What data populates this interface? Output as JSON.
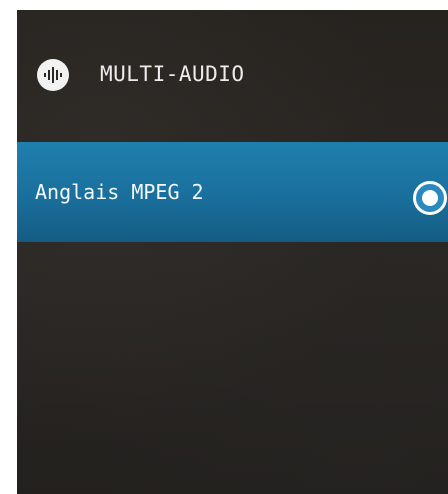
{
  "header": {
    "icon": "audio-waveform-icon",
    "title": "MULTI-AUDIO"
  },
  "options": [
    {
      "label": "Anglais MPEG 2",
      "selected": true
    }
  ],
  "colors": {
    "background": "#26231f",
    "selection": "#1a6f9c",
    "text": "#ececec"
  }
}
